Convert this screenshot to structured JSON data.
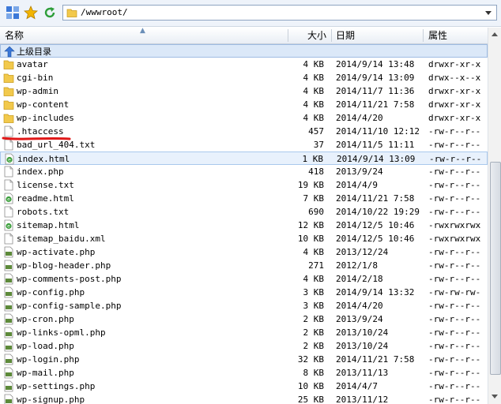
{
  "toolbar": {
    "path": "/wwwroot/"
  },
  "header": {
    "name": "名称",
    "size": "大小",
    "date": "日期",
    "perm": "属性"
  },
  "up_row": {
    "label": "上级目录"
  },
  "rows": [
    {
      "type": "folder",
      "name": "avatar",
      "size": "4 KB",
      "date": "2014/9/14 13:48",
      "perm": "drwxr-xr-x"
    },
    {
      "type": "folder",
      "name": "cgi-bin",
      "size": "4 KB",
      "date": "2014/9/14 13:09",
      "perm": "drwx--x--x"
    },
    {
      "type": "folder",
      "name": "wp-admin",
      "size": "4 KB",
      "date": "2014/11/7 11:36",
      "perm": "drwxr-xr-x"
    },
    {
      "type": "folder",
      "name": "wp-content",
      "size": "4 KB",
      "date": "2014/11/21 7:58",
      "perm": "drwxr-xr-x"
    },
    {
      "type": "folder",
      "name": "wp-includes",
      "size": "4 KB",
      "date": "2014/4/20",
      "perm": "drwxr-xr-x"
    },
    {
      "type": "file",
      "name": ".htaccess",
      "size": "457",
      "date": "2014/11/10 12:12",
      "perm": "-rw-r--r--"
    },
    {
      "type": "file",
      "name": "bad_url_404.txt",
      "size": "37",
      "date": "2014/11/5 11:11",
      "perm": "-rw-r--r--"
    },
    {
      "type": "html",
      "name": "index.html",
      "size": "1 KB",
      "date": "2014/9/14 13:09",
      "perm": "-rw-r--r--",
      "selected": true
    },
    {
      "type": "file",
      "name": "index.php",
      "size": "418",
      "date": "2013/9/24",
      "perm": "-rw-r--r--"
    },
    {
      "type": "file",
      "name": "license.txt",
      "size": "19 KB",
      "date": "2014/4/9",
      "perm": "-rw-r--r--"
    },
    {
      "type": "html",
      "name": "readme.html",
      "size": "7 KB",
      "date": "2014/11/21 7:58",
      "perm": "-rw-r--r--"
    },
    {
      "type": "file",
      "name": "robots.txt",
      "size": "690",
      "date": "2014/10/22 19:29",
      "perm": "-rw-r--r--"
    },
    {
      "type": "html",
      "name": "sitemap.html",
      "size": "12 KB",
      "date": "2014/12/5 10:46",
      "perm": "-rwxrwxrwx"
    },
    {
      "type": "file",
      "name": "sitemap_baidu.xml",
      "size": "10 KB",
      "date": "2014/12/5 10:46",
      "perm": "-rwxrwxrwx"
    },
    {
      "type": "php",
      "name": "wp-activate.php",
      "size": "4 KB",
      "date": "2013/12/24",
      "perm": "-rw-r--r--"
    },
    {
      "type": "php",
      "name": "wp-blog-header.php",
      "size": "271",
      "date": "2012/1/8",
      "perm": "-rw-r--r--"
    },
    {
      "type": "php",
      "name": "wp-comments-post.php",
      "size": "4 KB",
      "date": "2014/2/18",
      "perm": "-rw-r--r--"
    },
    {
      "type": "php",
      "name": "wp-config.php",
      "size": "3 KB",
      "date": "2014/9/14 13:32",
      "perm": "-rw-rw-rw-"
    },
    {
      "type": "php",
      "name": "wp-config-sample.php",
      "size": "3 KB",
      "date": "2014/4/20",
      "perm": "-rw-r--r--"
    },
    {
      "type": "php",
      "name": "wp-cron.php",
      "size": "2 KB",
      "date": "2013/9/24",
      "perm": "-rw-r--r--"
    },
    {
      "type": "php",
      "name": "wp-links-opml.php",
      "size": "2 KB",
      "date": "2013/10/24",
      "perm": "-rw-r--r--"
    },
    {
      "type": "php",
      "name": "wp-load.php",
      "size": "2 KB",
      "date": "2013/10/24",
      "perm": "-rw-r--r--"
    },
    {
      "type": "php",
      "name": "wp-login.php",
      "size": "32 KB",
      "date": "2014/11/21 7:58",
      "perm": "-rw-r--r--"
    },
    {
      "type": "php",
      "name": "wp-mail.php",
      "size": "8 KB",
      "date": "2013/11/13",
      "perm": "-rw-r--r--"
    },
    {
      "type": "php",
      "name": "wp-settings.php",
      "size": "10 KB",
      "date": "2014/4/7",
      "perm": "-rw-r--r--"
    },
    {
      "type": "php",
      "name": "wp-signup.php",
      "size": "25 KB",
      "date": "2013/11/12",
      "perm": "-rw-r--r--"
    }
  ],
  "colors": {
    "folder": "#f2c94c",
    "selection": "#e8f1fc",
    "annotation": "#e01818"
  }
}
